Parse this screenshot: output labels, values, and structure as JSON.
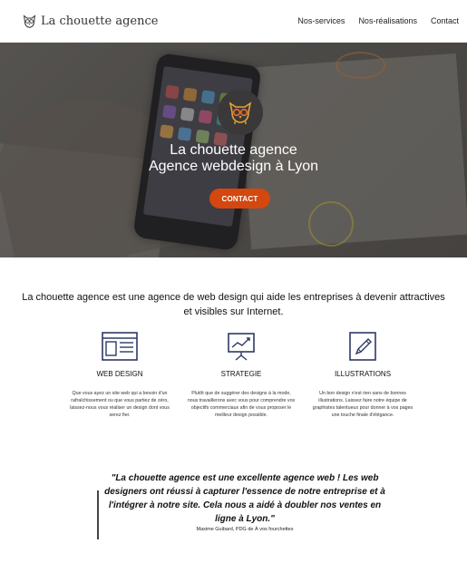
{
  "header": {
    "logo_text": "La chouette agence",
    "logo_icon": "owl-icon",
    "nav": [
      {
        "label": "Nos-services"
      },
      {
        "label": "Nos-réalisations"
      },
      {
        "label": "Contact"
      }
    ]
  },
  "hero": {
    "title_line1": "La chouette agence",
    "title_line2": "Agence webdesign à Lyon",
    "cta_label": "CONTACT",
    "badge_icon": "owl-icon",
    "cta_color": "#d4470f"
  },
  "intro": {
    "text": "La chouette agence est une agence de web design qui aide les entreprises à devenir attractives et visibles sur Internet."
  },
  "services": [
    {
      "icon": "webpage-icon",
      "title": "WEB DESIGN",
      "text": "Que vous ayez un site web qui a besoin d'un rafraîchissement ou que vous partiez de zéro, laissez-nous vous réaliser un design dont vous serez fier."
    },
    {
      "icon": "presentation-board-icon",
      "title": "STRATEGIE",
      "text": "Plutôt que de suggérer des designs à la mode, nous travaillerons avec vous pour comprendre vos objectifs commerciaux afin de vous proposer le meilleur design possible."
    },
    {
      "icon": "pencil-icon",
      "title": "ILLUSTRATIONS",
      "text": "Un bon design n'est rien sans de bonnes illustrations. Laissez faire notre équipe de graphistes talentueux pour donner à vos pages une touche finale d'élégance."
    }
  ],
  "testimonial": {
    "quote": "\"La chouette agence est une excellente agence web ! Les web designers ont réussi à capturer l'essence de notre entreprise et à l'intégrer à notre site. Cela nous a aidé à doubler nos ventes en ligne à Lyon.\"",
    "author": "Maxime Guibard, PDG de À vos fourchettes"
  },
  "colors": {
    "accent": "#d4470f",
    "icon_navy": "#2d3a63"
  }
}
